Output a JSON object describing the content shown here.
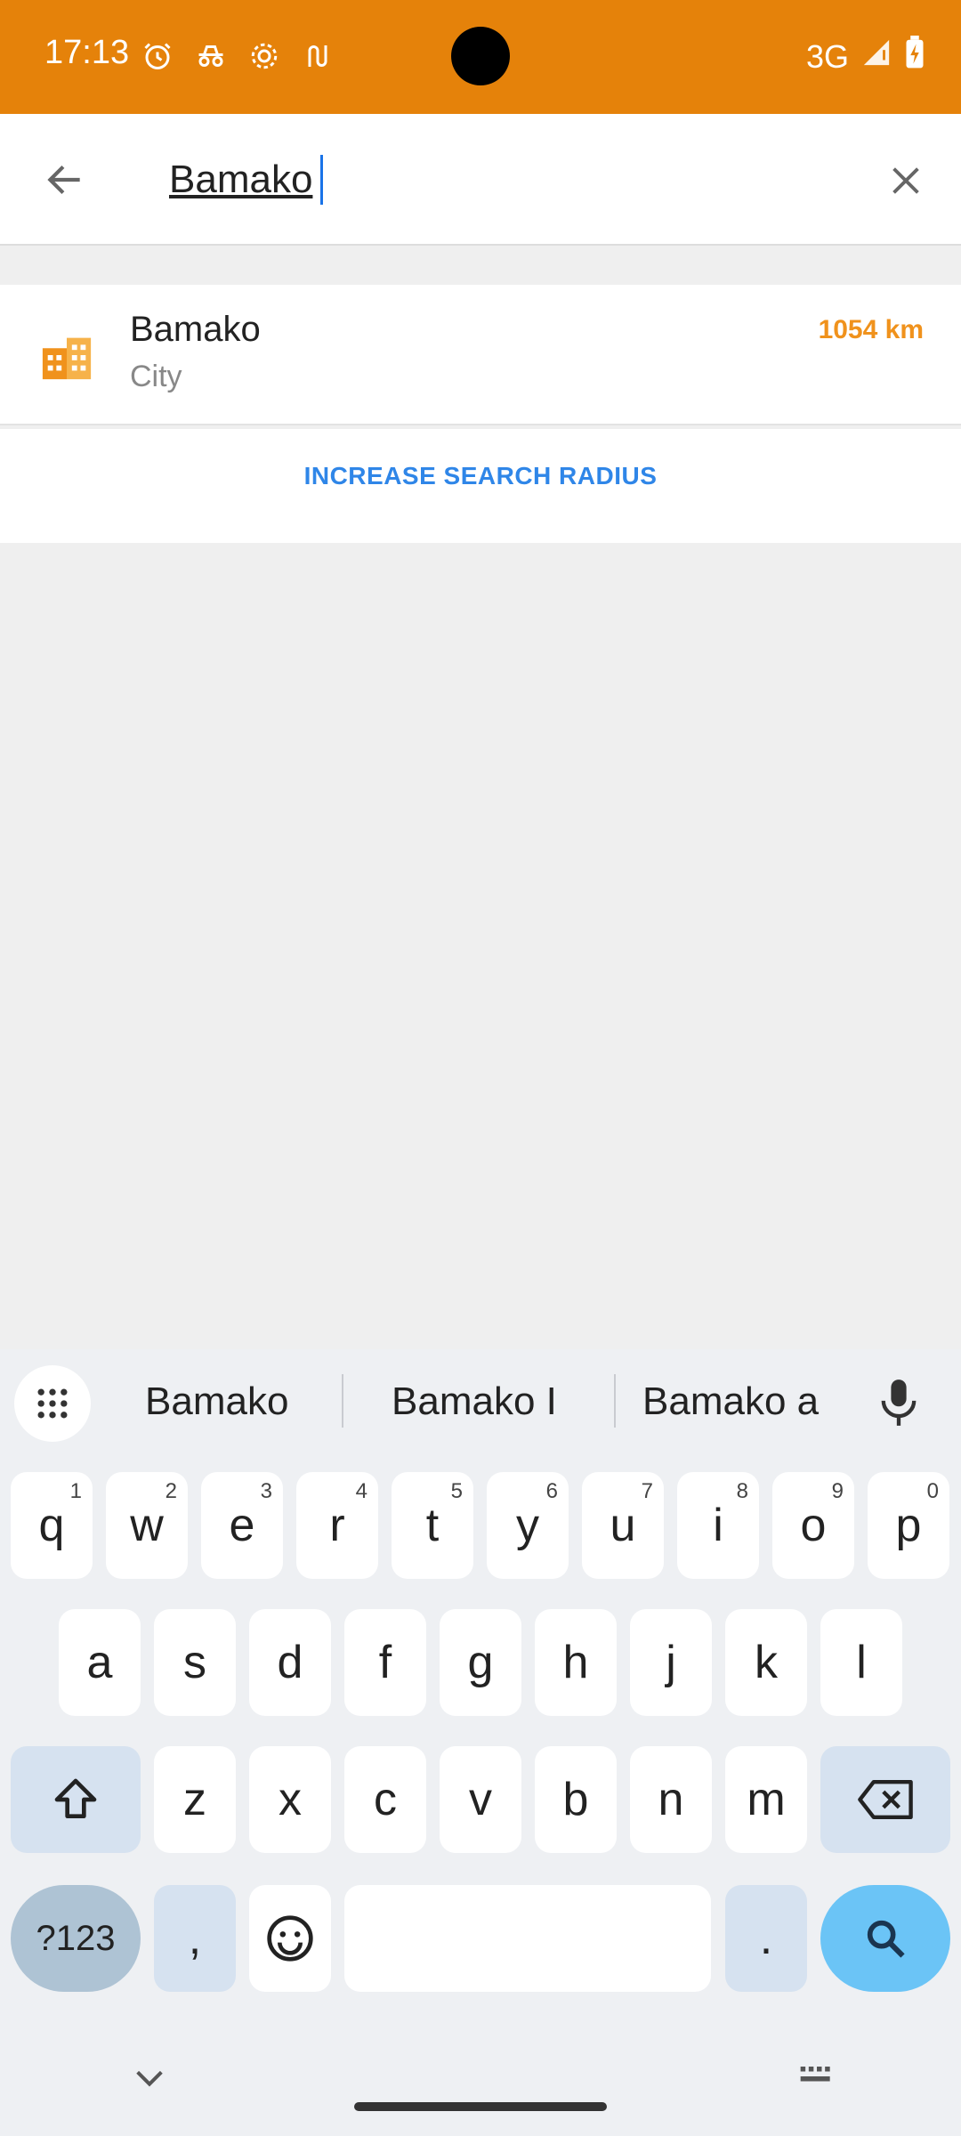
{
  "status_bar": {
    "time": "17:13",
    "icons_left": [
      "alarm-icon",
      "incognito-icon",
      "settings-gear-icon",
      "transit-icon"
    ],
    "network": "3G",
    "icons_right": [
      "signal-icon",
      "battery-charging-icon"
    ],
    "bg_color": "#e5820a"
  },
  "search": {
    "query": "Bamako",
    "back_icon": "arrow-left-icon",
    "clear_icon": "close-icon"
  },
  "results": [
    {
      "name": "Bamako",
      "type": "City",
      "distance": "1054 km",
      "icon": "city-buildings-icon"
    }
  ],
  "radius_button": {
    "label": "INCREASE SEARCH RADIUS"
  },
  "keyboard": {
    "suggestions": [
      "Bamako",
      "Bamako I",
      "Bamako a"
    ],
    "row1": [
      {
        "k": "q",
        "h": "1"
      },
      {
        "k": "w",
        "h": "2"
      },
      {
        "k": "e",
        "h": "3"
      },
      {
        "k": "r",
        "h": "4"
      },
      {
        "k": "t",
        "h": "5"
      },
      {
        "k": "y",
        "h": "6"
      },
      {
        "k": "u",
        "h": "7"
      },
      {
        "k": "i",
        "h": "8"
      },
      {
        "k": "o",
        "h": "9"
      },
      {
        "k": "p",
        "h": "0"
      }
    ],
    "row2": [
      "a",
      "s",
      "d",
      "f",
      "g",
      "h",
      "j",
      "k",
      "l"
    ],
    "row3": [
      "z",
      "x",
      "c",
      "v",
      "b",
      "n",
      "m"
    ],
    "symbols_label": "?123",
    "comma": ",",
    "period": ".",
    "accent_color": "#6bc4f6"
  }
}
